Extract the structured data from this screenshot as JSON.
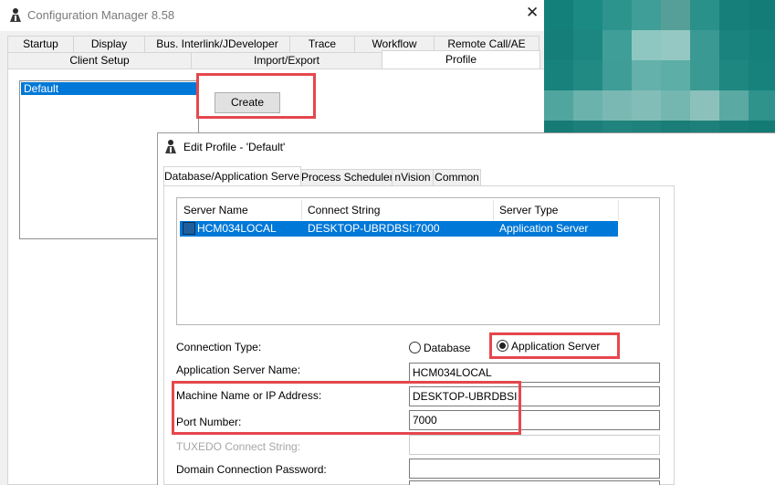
{
  "main_window": {
    "title": "Configuration Manager 8.58",
    "close_glyph": "✕",
    "tabs_row1": [
      "Startup",
      "Display",
      "Bus. Interlink/JDeveloper",
      "Trace",
      "Workflow",
      "Remote Call/AE"
    ],
    "tabs_row2": [
      "Client Setup",
      "Import/Export",
      "Profile"
    ],
    "active_tab": "Profile",
    "profiles": [
      "Default"
    ],
    "create_button": "Create"
  },
  "dialog": {
    "title": "Edit Profile - 'Default'",
    "tabs": [
      "Database/Application Server",
      "Process Scheduler",
      "nVision",
      "Common"
    ],
    "active_tab": "Database/Application Server",
    "server_table": {
      "columns": [
        "Server Name",
        "Connect String",
        "Server Type"
      ],
      "rows": [
        {
          "server_name": "HCM034LOCAL",
          "connect_string": "DESKTOP-UBRDBSI:7000",
          "server_type": "Application Server"
        }
      ]
    },
    "connection_type": {
      "label": "Connection Type:",
      "options": [
        "Database",
        "Application Server"
      ],
      "selected": "Application Server"
    },
    "fields": {
      "app_server_name": {
        "label": "Application Server Name:",
        "value": "HCM034LOCAL"
      },
      "machine_name": {
        "label": "Machine Name or IP Address:",
        "value": "DESKTOP-UBRDBSI"
      },
      "port_number": {
        "label": "Port Number:",
        "value": "7000"
      },
      "tuxedo_connect": {
        "label": "TUXEDO Connect String:",
        "value": ""
      },
      "domain_password": {
        "label": "Domain Connection Password:",
        "value": ""
      }
    }
  },
  "colors": {
    "highlight_box": "#e5474d",
    "selection": "#0078d7",
    "pixel_teal": "#127d75"
  },
  "icons": [
    "app-icon",
    "close-icon",
    "server-icon",
    "dialog-app-icon"
  ]
}
